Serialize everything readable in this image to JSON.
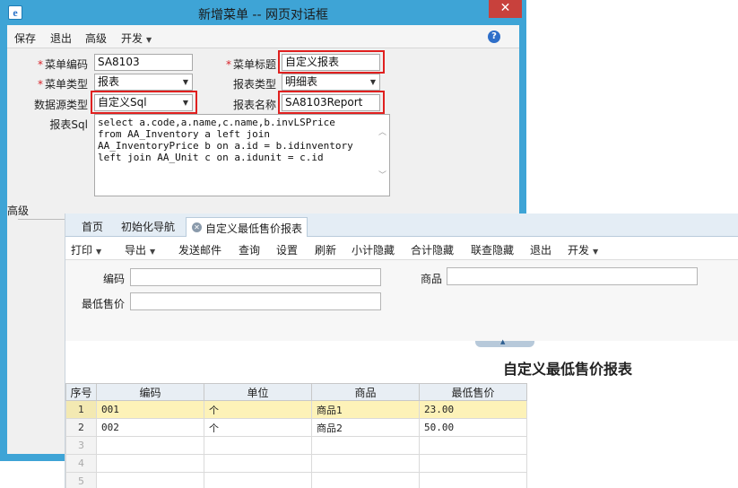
{
  "dialog": {
    "title": "新增菜单 -- 网页对话框",
    "close_glyph": "✕",
    "app_icon": "e",
    "toolbar": {
      "save": "保存",
      "exit": "退出",
      "advanced": "高级",
      "develop": "开发",
      "help_glyph": "?"
    },
    "form": {
      "menu_code_label": "菜单编码",
      "menu_code_value": "SA8103",
      "menu_title_label": "菜单标题",
      "menu_title_value": "自定义报表",
      "menu_type_label": "菜单类型",
      "menu_type_value": "报表",
      "report_type_label": "报表类型",
      "report_type_value": "明细表",
      "datasource_type_label": "数据源类型",
      "datasource_type_value": "自定义Sql",
      "report_name_label": "报表名称",
      "report_name_value": "SA8103Report",
      "report_sql_label": "报表Sql",
      "report_sql_lines": [
        "select a.code,a.name,c.name,b.invLSPrice",
        "from AA_Inventory a left join",
        "AA_InventoryPrice b on a.id = b.idinventory",
        "left join AA_Unit c on a.idunit = c.id"
      ],
      "required_mark": "*"
    },
    "section_label": "高级"
  },
  "report": {
    "tabs": {
      "home": "首页",
      "init_nav": "初始化导航",
      "active": "自定义最低售价报表",
      "close_glyph": "✕"
    },
    "toolbar": {
      "print": "打印",
      "export": "导出",
      "send_mail": "发送邮件",
      "query": "查询",
      "settings": "设置",
      "refresh": "刷新",
      "subtotal_hide": "小计隐藏",
      "total_hide": "合计隐藏",
      "link_hide": "联查隐藏",
      "exit": "退出",
      "develop": "开发"
    },
    "filter": {
      "code_label": "编码",
      "product_label": "商品",
      "min_price_label": "最低售价"
    },
    "title": "自定义最低售价报表",
    "table": {
      "headers": [
        "序号",
        "编码",
        "单位",
        "商品",
        "最低售价"
      ],
      "rows": [
        {
          "seq": "1",
          "code": "001",
          "unit": "个",
          "product": "商品1",
          "price": "23.00"
        },
        {
          "seq": "2",
          "code": "002",
          "unit": "个",
          "product": "商品2",
          "price": "50.00"
        }
      ],
      "empty_rows": [
        "3",
        "4",
        "5"
      ]
    }
  },
  "colors": {
    "window_frame": "#3ea4d6",
    "close_button": "#c8413c",
    "highlight_box": "#e0201f",
    "selected_row": "#fdf2b8",
    "required_mark": "#d8232a"
  }
}
